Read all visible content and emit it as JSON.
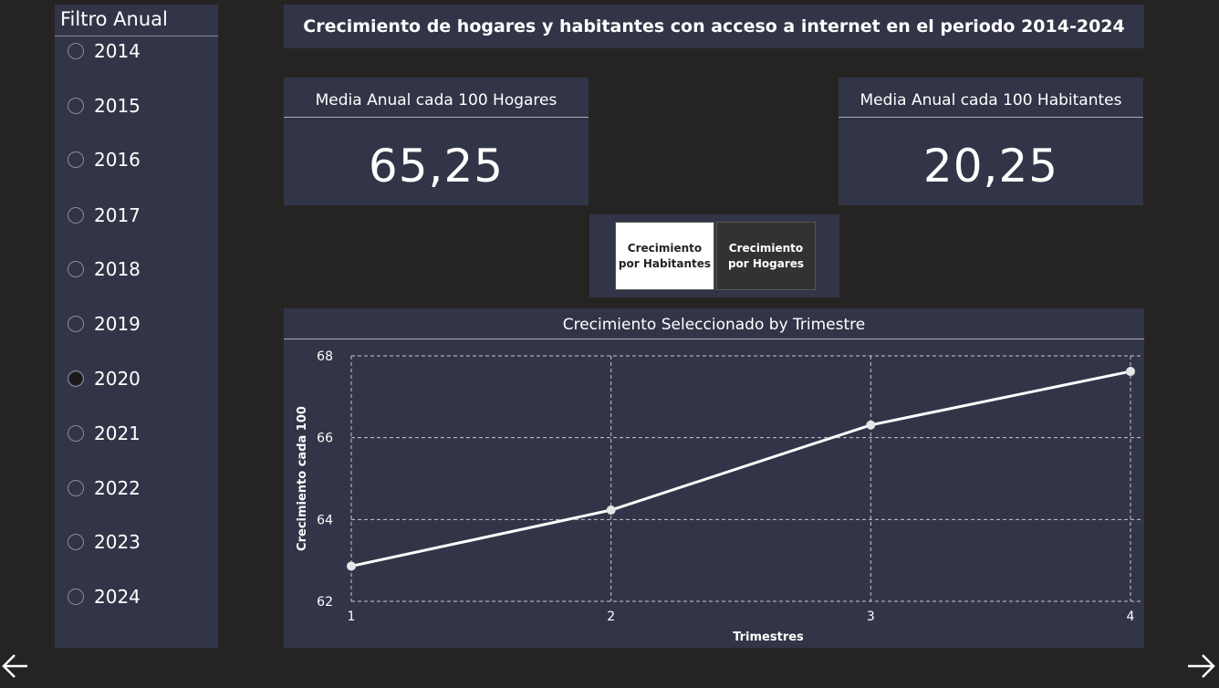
{
  "filter": {
    "title": "Filtro Anual",
    "selected": "2020",
    "years": [
      "2014",
      "2015",
      "2016",
      "2017",
      "2018",
      "2019",
      "2020",
      "2021",
      "2022",
      "2023",
      "2024"
    ]
  },
  "header": {
    "title": "Crecimiento de hogares y habitantes con acceso a internet en el periodo 2014-2024"
  },
  "kpi_hogares": {
    "label": "Media Anual cada 100 Hogares",
    "value": "65,25"
  },
  "kpi_habitantes": {
    "label": "Media Anual cada 100 Habitantes",
    "value": "20,25"
  },
  "toggle": {
    "habitantes_line1": "Crecimiento",
    "habitantes_line2": "por Habitantes",
    "hogares_line1": "Crecimiento",
    "hogares_line2": "por Hogares",
    "active": "habitantes"
  },
  "chart_data": {
    "type": "line",
    "title": "Crecimiento Seleccionado by Trimestre",
    "xlabel": "Trimestres",
    "ylabel": "Crecimiento cada 100",
    "x": [
      1,
      2,
      3,
      4
    ],
    "series": [
      {
        "values": [
          62.86,
          64.23,
          66.31,
          67.62
        ]
      }
    ],
    "ylim": [
      62,
      68
    ],
    "yticks": [
      62,
      64,
      66,
      68
    ],
    "grid": true
  },
  "nav": {
    "prev_icon": "arrow-left-icon",
    "next_icon": "arrow-right-icon"
  },
  "colors": {
    "background": "#252423",
    "panel": "#323547",
    "line": "#ffffff"
  }
}
